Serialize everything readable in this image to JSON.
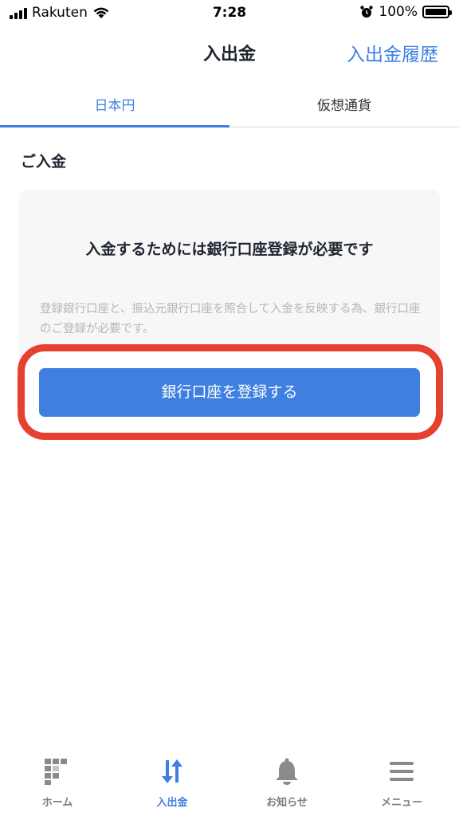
{
  "status_bar": {
    "carrier": "Rakuten",
    "time": "7:28",
    "battery": "100%",
    "battery_level": 1.0
  },
  "nav": {
    "title": "入出金",
    "history_link": "入出金履歴"
  },
  "tabs": [
    {
      "label": "日本円",
      "active": true
    },
    {
      "label": "仮想通貨",
      "active": false
    }
  ],
  "deposit": {
    "heading": "ご入金",
    "card_title": "入金するためには銀行口座登録が必要です",
    "description": "登録銀行口座と、振込元銀行口座を照合して入金を反映する為、銀行口座のご登録が必要です。",
    "register_button": "銀行口座を登録する"
  },
  "bottom_tabs": [
    {
      "label": "ホーム",
      "icon": "home-icon",
      "active": false
    },
    {
      "label": "入出金",
      "icon": "transfer-icon",
      "active": true
    },
    {
      "label": "お知らせ",
      "icon": "bell-icon",
      "active": false
    },
    {
      "label": "メニュー",
      "icon": "menu-icon",
      "active": false
    }
  ],
  "colors": {
    "accent": "#3e7fe0",
    "highlight_ring": "#e5412f",
    "inactive_icon": "#8a8a8a"
  }
}
